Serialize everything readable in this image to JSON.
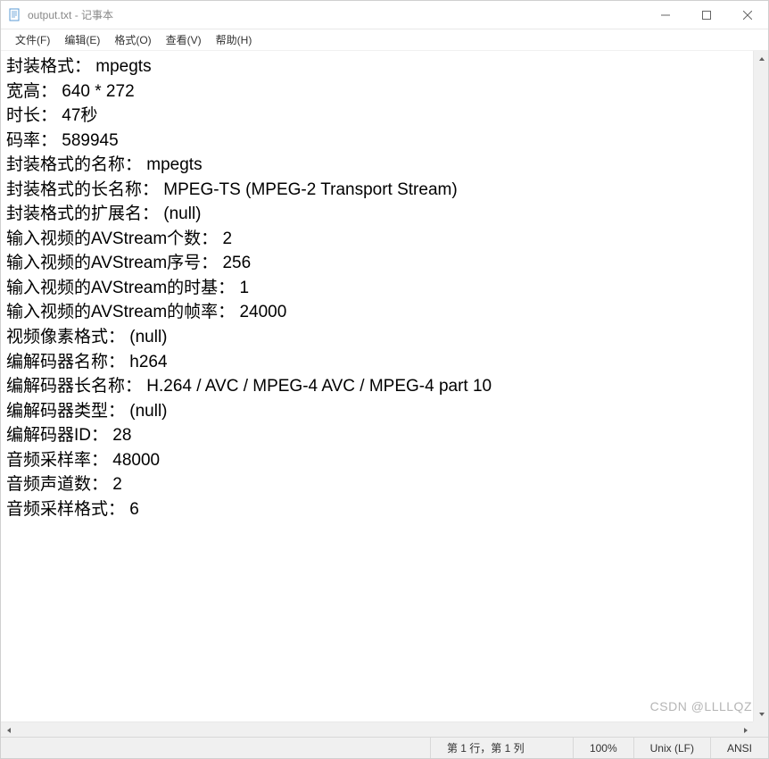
{
  "window": {
    "title": "output.txt - 记事本"
  },
  "menu": {
    "file": "文件(F)",
    "edit": "编辑(E)",
    "format": "格式(O)",
    "view": "查看(V)",
    "help": "帮助(H)"
  },
  "content": "封装格式： mpegts\n宽高： 640 * 272\n时长： 47秒\n码率： 589945\n封装格式的名称： mpegts\n封装格式的长名称： MPEG-TS (MPEG-2 Transport Stream)\n封装格式的扩展名： (null)\n输入视频的AVStream个数： 2\n输入视频的AVStream序号： 256\n输入视频的AVStream的时基： 1\n输入视频的AVStream的帧率： 24000\n视频像素格式： (null)\n编解码器名称： h264\n编解码器长名称： H.264 / AVC / MPEG-4 AVC / MPEG-4 part 10\n编解码器类型： (null)\n编解码器ID： 28\n音频采样率： 48000\n音频声道数： 2\n音频采样格式： 6",
  "status": {
    "position": "第 1 行，第 1 列",
    "zoom": "100%",
    "line_ending": "Unix (LF)",
    "encoding": "ANSI"
  },
  "watermark": "CSDN @LLLLQZ"
}
